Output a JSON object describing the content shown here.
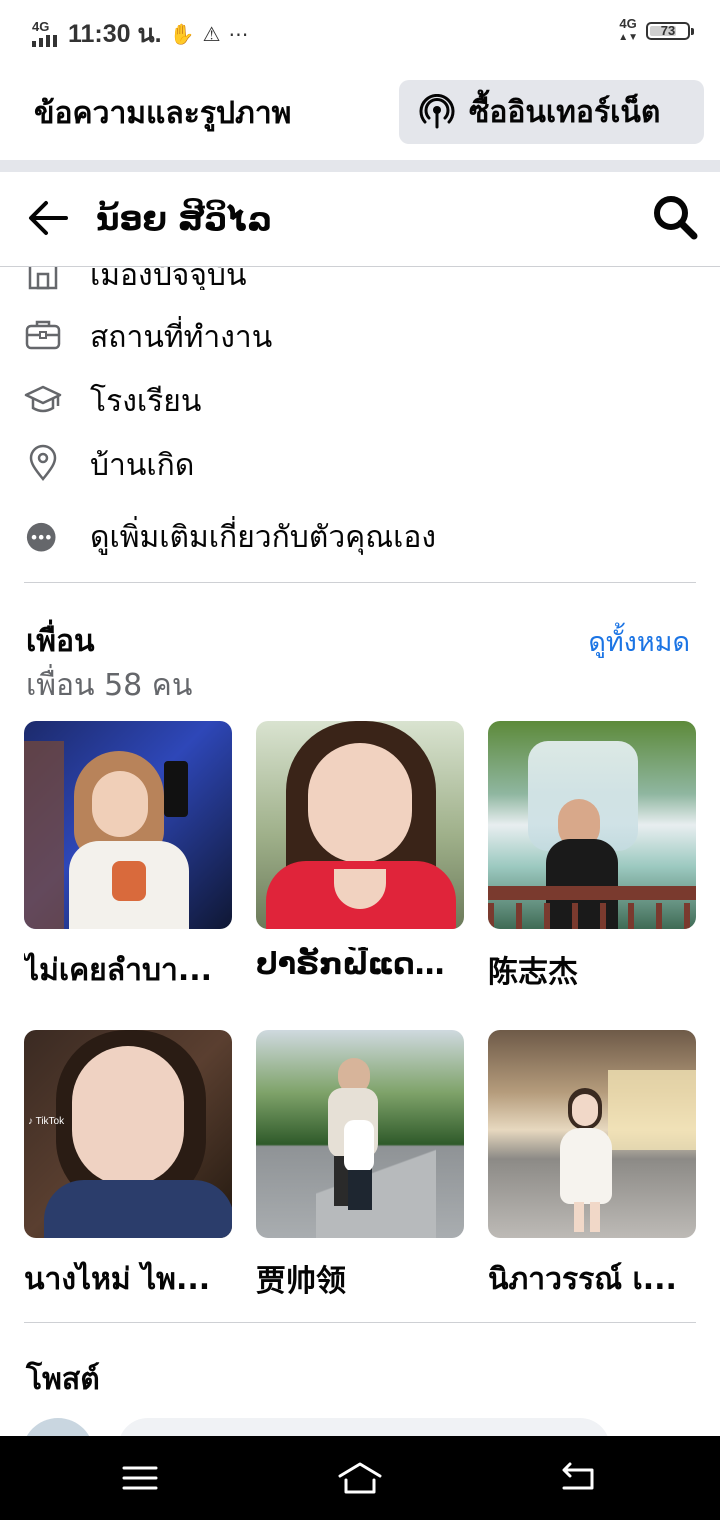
{
  "status_bar": {
    "network_label": "4G",
    "time": "11:30 น.",
    "right_network": "4G",
    "battery": "73",
    "battery_level": 0.73
  },
  "banner": {
    "mode_label": "ข้อความและรูปภาพ",
    "buy_internet_label": "ซื้ออินเทอร์เน็ต"
  },
  "header": {
    "title": "ນ້ອຍ ສີວິໄລ"
  },
  "about": {
    "items": [
      {
        "label": "เมืองปัจจุบัน",
        "icon": "building-icon"
      },
      {
        "label": "สถานที่ทำงาน",
        "icon": "briefcase-icon"
      },
      {
        "label": "โรงเรียน",
        "icon": "graduation-cap-icon"
      },
      {
        "label": "บ้านเกิด",
        "icon": "location-pin-icon"
      },
      {
        "label": "ดูเพิ่มเติมเกี่ยวกับตัวคุณเอง",
        "icon": "more-dots-icon"
      }
    ]
  },
  "friends": {
    "title": "เพื่อน",
    "see_all": "ดูทั้งหมด",
    "count": "เพื่อน 58 คน",
    "list": [
      {
        "name": "ไม่เคยลำบา..."
      },
      {
        "name": "ປາຣັກຝີແດນ..."
      },
      {
        "name": "陈志杰"
      },
      {
        "name": "นางไหม่ ไพ..."
      },
      {
        "name": "贾帅领"
      },
      {
        "name": "นิภาวรรณ์ เ..."
      }
    ]
  },
  "posts": {
    "title": "โพสต์"
  },
  "colors": {
    "accent": "#1b74e4",
    "secondary_text": "#65676b",
    "divider": "#ced0d4",
    "button_bg": "#e4e6eb"
  }
}
